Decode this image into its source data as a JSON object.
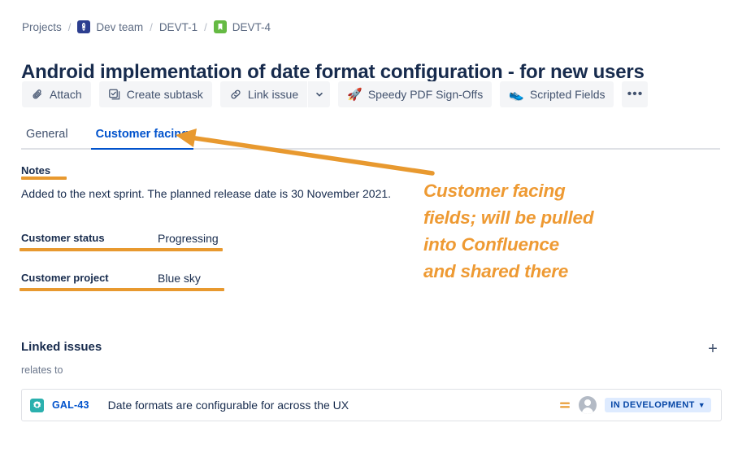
{
  "breadcrumb": {
    "name": "breadcrumb",
    "items": [
      {
        "label": "Projects",
        "icon": null
      },
      {
        "label": "Dev team",
        "icon": "dev-team-project-icon"
      },
      {
        "label": "DEVT-1",
        "icon": null
      },
      {
        "label": "DEVT-4",
        "icon": "story-issue-type-icon"
      }
    ],
    "separator": "/"
  },
  "title": "Android implementation of date format configuration - for new users",
  "toolbar": {
    "attach_label": "Attach",
    "attach_icon": "paperclip-icon",
    "create_subtask_label": "Create subtask",
    "create_subtask_icon": "checkbox-task-icon",
    "link_issue_label": "Link issue",
    "link_issue_icon": "chain-link-icon",
    "link_issue_caret_icon": "chevron-down-icon",
    "speedy_pdf_label": "Speedy PDF Sign-Offs",
    "speedy_pdf_icon": "rocket-icon",
    "scripted_fields_label": "Scripted Fields",
    "scripted_fields_icon": "sneaker-icon",
    "more_label": "•••",
    "more_icon": "more-actions-icon"
  },
  "tabs": [
    {
      "label": "General",
      "active": false
    },
    {
      "label": "Customer facing",
      "active": true
    }
  ],
  "content": {
    "notes_label": "Notes",
    "notes_text": "Added to the next sprint. The planned release date is 30 November 2021.",
    "fields": [
      {
        "name": "Customer status",
        "value": "Progressing"
      },
      {
        "name": "Customer project",
        "value": "Blue sky"
      }
    ]
  },
  "linked_issues": {
    "heading": "Linked issues",
    "add_button_label": "+",
    "add_button_icon": "plus-icon",
    "link_type": "relates to",
    "rows": [
      {
        "key": "GAL-43",
        "issue_type_icon": "gear-issue-type-icon",
        "summary": "Date formats are configurable for across the UX",
        "priority_icon": "medium-priority-icon",
        "assignee_icon": "user-avatar-icon",
        "status": "IN DEVELOPMENT",
        "status_chevron": "⌄"
      }
    ]
  },
  "annotations": {
    "callout_text": "Customer facing fields; will be pulled into Confluence and shared there",
    "callout_lines": [
      "Customer facing",
      "fields; will be pulled",
      "into Confluence",
      "and shared there"
    ],
    "arrow_icon": "arrow-pointing-left-icon",
    "color": "#E8992F"
  },
  "colors": {
    "accent_blue": "#0052CC",
    "text": "#172B4D",
    "muted_text": "#5E6C84",
    "annotation_orange": "#E8992F",
    "status_badge_bg": "#DEEBFF",
    "status_badge_text": "#0747A6",
    "button_bg": "#F4F5F7"
  }
}
